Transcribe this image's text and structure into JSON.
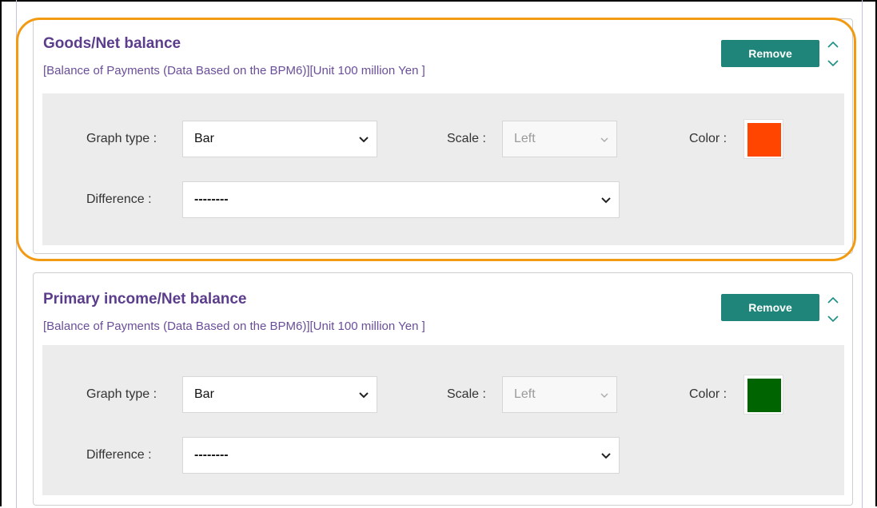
{
  "series": [
    {
      "title": "Goods/Net balance",
      "subtitle": "[Balance of Payments (Data Based on the BPM6)][Unit 100 million Yen ]",
      "remove_label": "Remove",
      "graph_type_label": "Graph type :",
      "graph_type_value": "Bar",
      "scale_label": "Scale :",
      "scale_value": "Left",
      "color_label": "Color :",
      "color_value": "#ff4500",
      "difference_label": "Difference :",
      "difference_value": "--------"
    },
    {
      "title": "Primary income/Net balance",
      "subtitle": "[Balance of Payments (Data Based on the BPM6)][Unit 100 million Yen ]",
      "remove_label": "Remove",
      "graph_type_label": "Graph type :",
      "graph_type_value": "Bar",
      "scale_label": "Scale :",
      "scale_value": "Left",
      "color_label": "Color :",
      "color_value": "#006400",
      "difference_label": "Difference :",
      "difference_value": "--------"
    }
  ],
  "colors": {
    "title": "#5b3d8c",
    "remove_button": "#1f857a",
    "highlight": "#f29a12"
  },
  "icons": {
    "move_up": "chevron-up-icon",
    "move_down": "chevron-down-icon",
    "dropdown": "chevron-down-icon"
  }
}
